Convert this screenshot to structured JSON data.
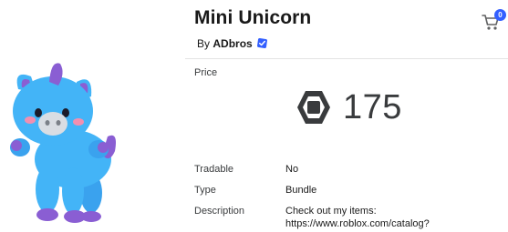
{
  "item": {
    "title": "Mini Unicorn",
    "by_prefix": "By",
    "creator": "ADbros",
    "image_alt": "Mini Unicorn thumbnail"
  },
  "cart": {
    "count": "0",
    "icon": "shopping-cart-icon"
  },
  "price": {
    "label": "Price",
    "amount": "175",
    "currency_icon": "robux-icon"
  },
  "details": {
    "tradable": {
      "label": "Tradable",
      "value": "No"
    },
    "type": {
      "label": "Type",
      "value": "Bundle"
    },
    "description": {
      "label": "Description",
      "line1": "Check out my items:",
      "line2": "https://www.roblox.com/catalog?"
    }
  },
  "colors": {
    "accent": "#335fff",
    "divider": "#e3e3e3",
    "text": "#393b3d"
  }
}
